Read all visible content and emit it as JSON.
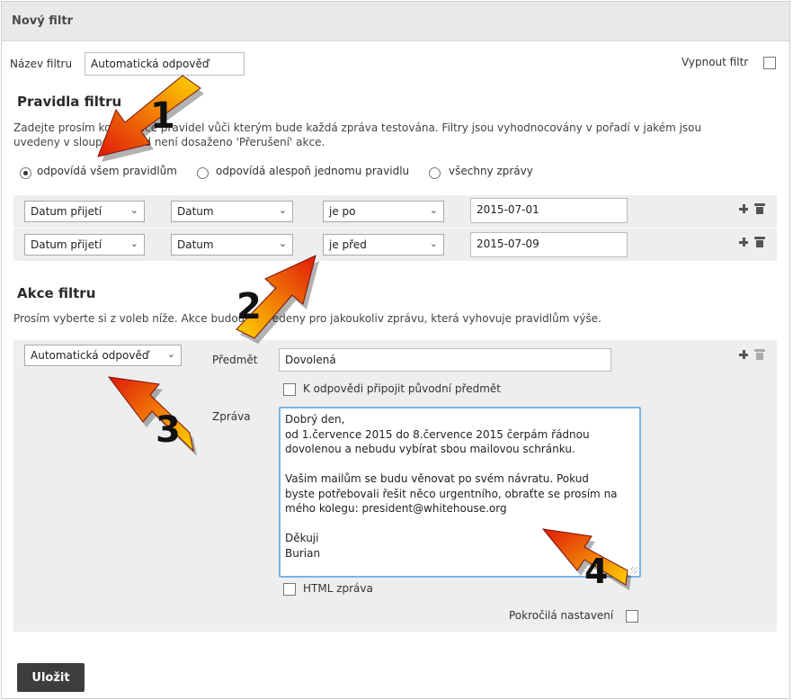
{
  "dialog": {
    "title": "Nový filtr"
  },
  "filter_name": {
    "label": "Název filtru",
    "value": "Automatická odpověď"
  },
  "disable_filter": {
    "label": "Vypnout filtr",
    "checked": false
  },
  "rules": {
    "heading": "Pravidla filtru",
    "description_line1": "Zadejte prosím kombinace pravidel vůči kterým bude každá zpráva testována. Filtry jsou vyhodnocovány v pořadí v jakém jsou",
    "description_line2": "uvedeny v sloupci, pokud není dosaženo 'Přerušení' akce.",
    "match_options": [
      {
        "label": "odpovídá všem pravidlům",
        "selected": true
      },
      {
        "label": "odpovídá alespoň jednomu pravidlu",
        "selected": false
      },
      {
        "label": "všechny zprávy",
        "selected": false
      }
    ],
    "rows": [
      {
        "field": "Datum přijetí",
        "type": "Datum",
        "operator": "je po",
        "value": "2015-07-01"
      },
      {
        "field": "Datum přijetí",
        "type": "Datum",
        "operator": "je před",
        "value": "2015-07-09"
      }
    ]
  },
  "actions": {
    "heading": "Akce filtru",
    "description": "Prosím vyberte si z voleb níže. Akce budou provedeny pro jakoukoliv zprávu, která vyhovuje pravidlům výše.",
    "action_select": "Automatická odpověď",
    "subject_label": "Předmět",
    "subject_value": "Dovolená",
    "attach_original_label": "K odpovědi připojit původní předmět",
    "message_label": "Zpráva",
    "message_lines": [
      "Dobrý den,",
      "od 1.července 2015 do 8.července 2015 čerpám řádnou",
      "dovolenou a nebudu vybírat sbou mailovou schránku.",
      "",
      "Vašim mailům se budu věnovat po svém návratu. Pokud",
      "byste potřebovali řešit něco urgentního, obraťte se prosím na",
      "mého kolegu: president@whitehouse.org",
      "",
      "Děkuji",
      "Burian"
    ],
    "html_message_label": "HTML zpráva",
    "advanced_label": "Pokročilá nastavení"
  },
  "save_button": "Uložit",
  "callouts": [
    "1",
    "2",
    "3",
    "4"
  ],
  "colors": {
    "title_bar": "#e9e9e9",
    "band": "#eeeeee",
    "button": "#3d3d3d",
    "focus_border": "#7bb3e8",
    "arrow_red": "#e02010",
    "arrow_yellow": "#ffcc00"
  },
  "icons": [
    "plus-icon",
    "trash-icon",
    "chevron-down-icon"
  ]
}
